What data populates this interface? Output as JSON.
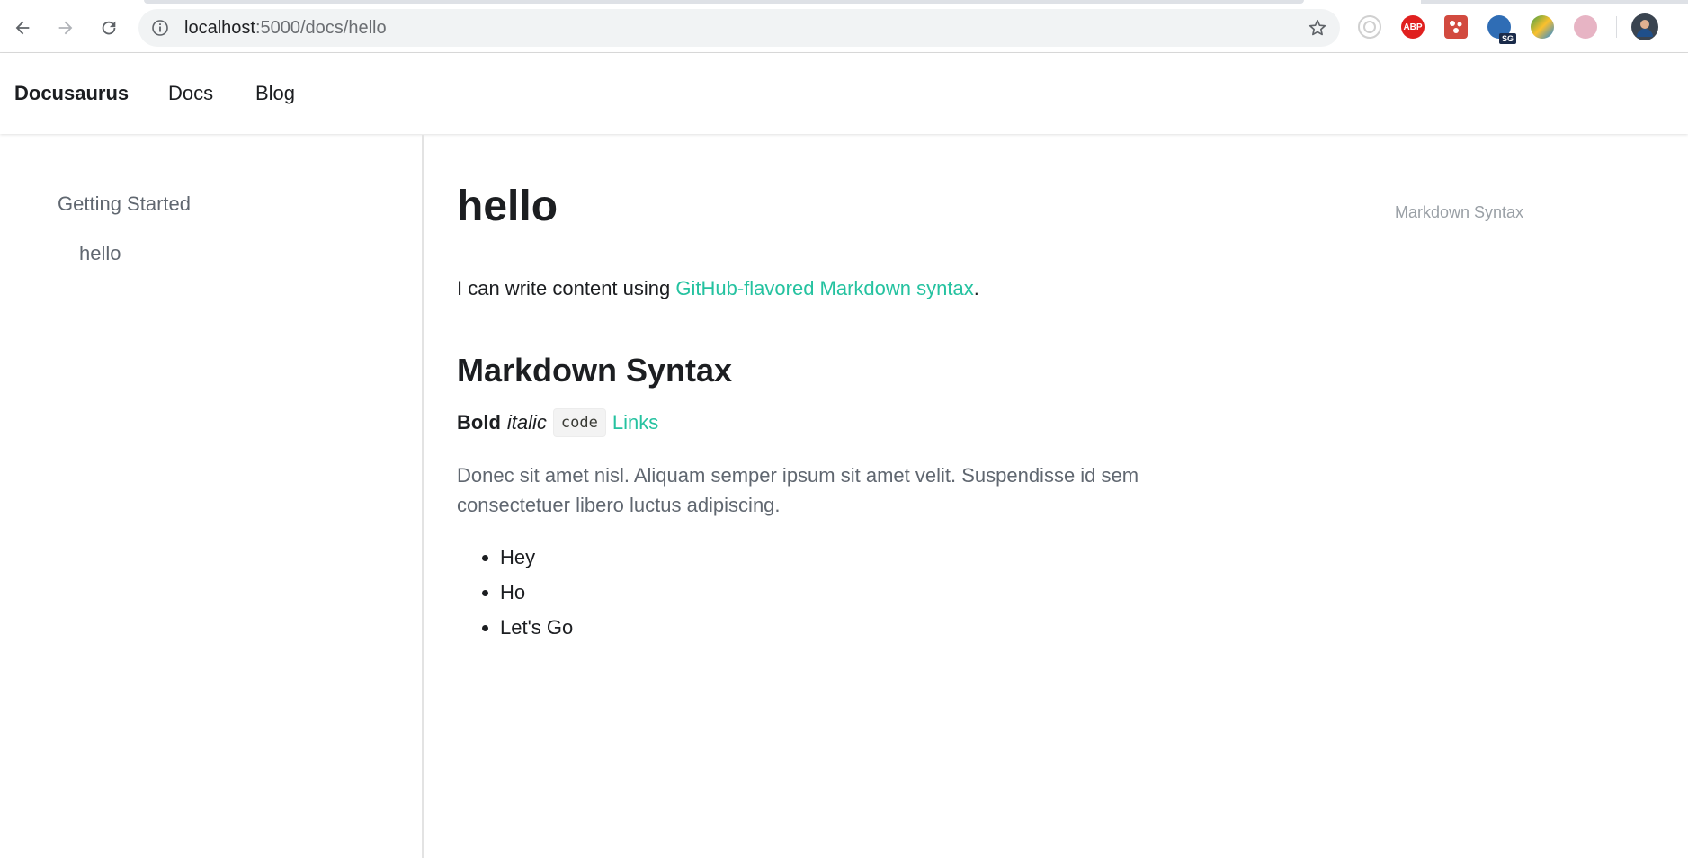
{
  "browser": {
    "url_host": "localhost",
    "url_path": ":5000/docs/hello",
    "extensions": [
      {
        "name": "target-icon",
        "color": "#bdbdbd"
      },
      {
        "name": "adblock-icon",
        "label": "ABP",
        "color": "#e0201f"
      },
      {
        "name": "puzzle-extension-icon",
        "color": "#d24a3f"
      },
      {
        "name": "globe-sg-icon",
        "label": "SG",
        "color": "#2f6db5"
      },
      {
        "name": "colorful-globe-icon",
        "color": "#43a047"
      },
      {
        "name": "flag-icon",
        "color": "#e07a9a"
      }
    ]
  },
  "navbar": {
    "brand": "Docusaurus",
    "links": [
      "Docs",
      "Blog"
    ]
  },
  "sidebar": {
    "category": "Getting Started",
    "items": [
      "hello"
    ]
  },
  "content": {
    "title": "hello",
    "intro_prefix": "I can write content using ",
    "intro_link": "GitHub-flavored Markdown syntax",
    "intro_suffix": ".",
    "heading": "Markdown Syntax",
    "bold": "Bold",
    "italic": "italic",
    "code": "code",
    "links": "Links",
    "quote": "Donec sit amet nisl. Aliquam semper ipsum sit amet velit. Suspendisse id sem consectetuer libero luctus adipiscing.",
    "list": [
      "Hey",
      "Ho",
      "Let's Go"
    ]
  },
  "toc": {
    "items": [
      "Markdown Syntax"
    ]
  },
  "colors": {
    "accent": "#25c2a0",
    "text": "#1c1e21",
    "muted": "#606770"
  }
}
